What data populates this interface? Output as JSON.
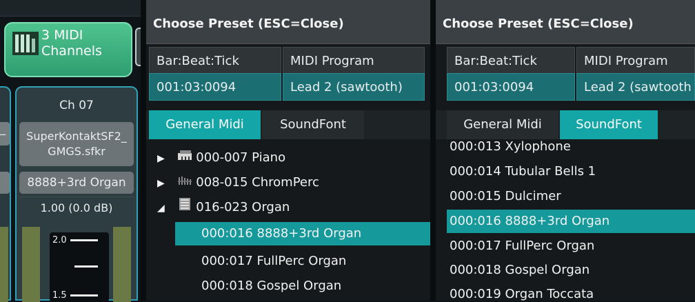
{
  "mixer": {
    "midi_button_label": "3 MIDI Channels",
    "midi_line1": "3 MIDI",
    "midi_line2": "Channels",
    "channel": {
      "title": "Ch 07",
      "soundfont_line1": "SuperKontaktSF2_",
      "soundfont_line2": "GMGS.sfkr",
      "program": "8888+3rd Organ",
      "volume": "1.00 (0.0 dB)",
      "fader_scale": [
        "2.0",
        "1.5"
      ]
    },
    "prev_channel_fragment": "_"
  },
  "panel_left": {
    "title": "Choose Preset (ESC=Close)",
    "col_headers": [
      "Bar:Beat:Tick",
      "MIDI Program"
    ],
    "values": [
      "001:03:0094",
      "Lead 2 (sawtooth)"
    ],
    "tabs": [
      "General Midi",
      "SoundFont"
    ],
    "active_tab": "General Midi",
    "tree": [
      {
        "kind": "group",
        "arrow": "▶",
        "icon": "piano-icon",
        "label": "000-007 Piano",
        "expanded": false
      },
      {
        "kind": "group",
        "arrow": "▶",
        "icon": "chromatic-percussion-icon",
        "label": "008-015 ChromPerc",
        "expanded": false
      },
      {
        "kind": "group",
        "arrow": "◢",
        "icon": "organ-icon",
        "label": "016-023 Organ",
        "expanded": true
      },
      {
        "kind": "item",
        "label": "000:016 8888+3rd Organ",
        "selected": true
      },
      {
        "kind": "item",
        "label": "000:017 FullPerc Organ",
        "selected": false
      },
      {
        "kind": "item",
        "label": "000:018 Gospel Organ",
        "selected": false
      }
    ]
  },
  "panel_right": {
    "title": "Choose Preset (ESC=Close)",
    "col_headers": [
      "Bar:Beat:Tick",
      "MIDI Program"
    ],
    "values": [
      "001:03:0094",
      "Lead 2 (sawtooth"
    ],
    "tabs": [
      "General Midi",
      "SoundFont"
    ],
    "active_tab": "SoundFont",
    "list": [
      {
        "label": "000:013 Xylophone",
        "selected": false
      },
      {
        "label": "000:014 Tubular Bells 1",
        "selected": false
      },
      {
        "label": "000:015 Dulcimer",
        "selected": false
      },
      {
        "label": "000:016 8888+3rd Organ",
        "selected": true
      },
      {
        "label": "000:017 FullPerc Organ",
        "selected": false
      },
      {
        "label": "000:018 Gospel Organ",
        "selected": false
      },
      {
        "label": "000:019 Organ Toccata",
        "selected": false
      }
    ]
  },
  "colors": {
    "accent_teal": "#14a6a6",
    "selection": "#15999b",
    "value_cell": "#1b6e72",
    "midi_button": "#3fb583",
    "channel_border": "#2fa3b8"
  }
}
